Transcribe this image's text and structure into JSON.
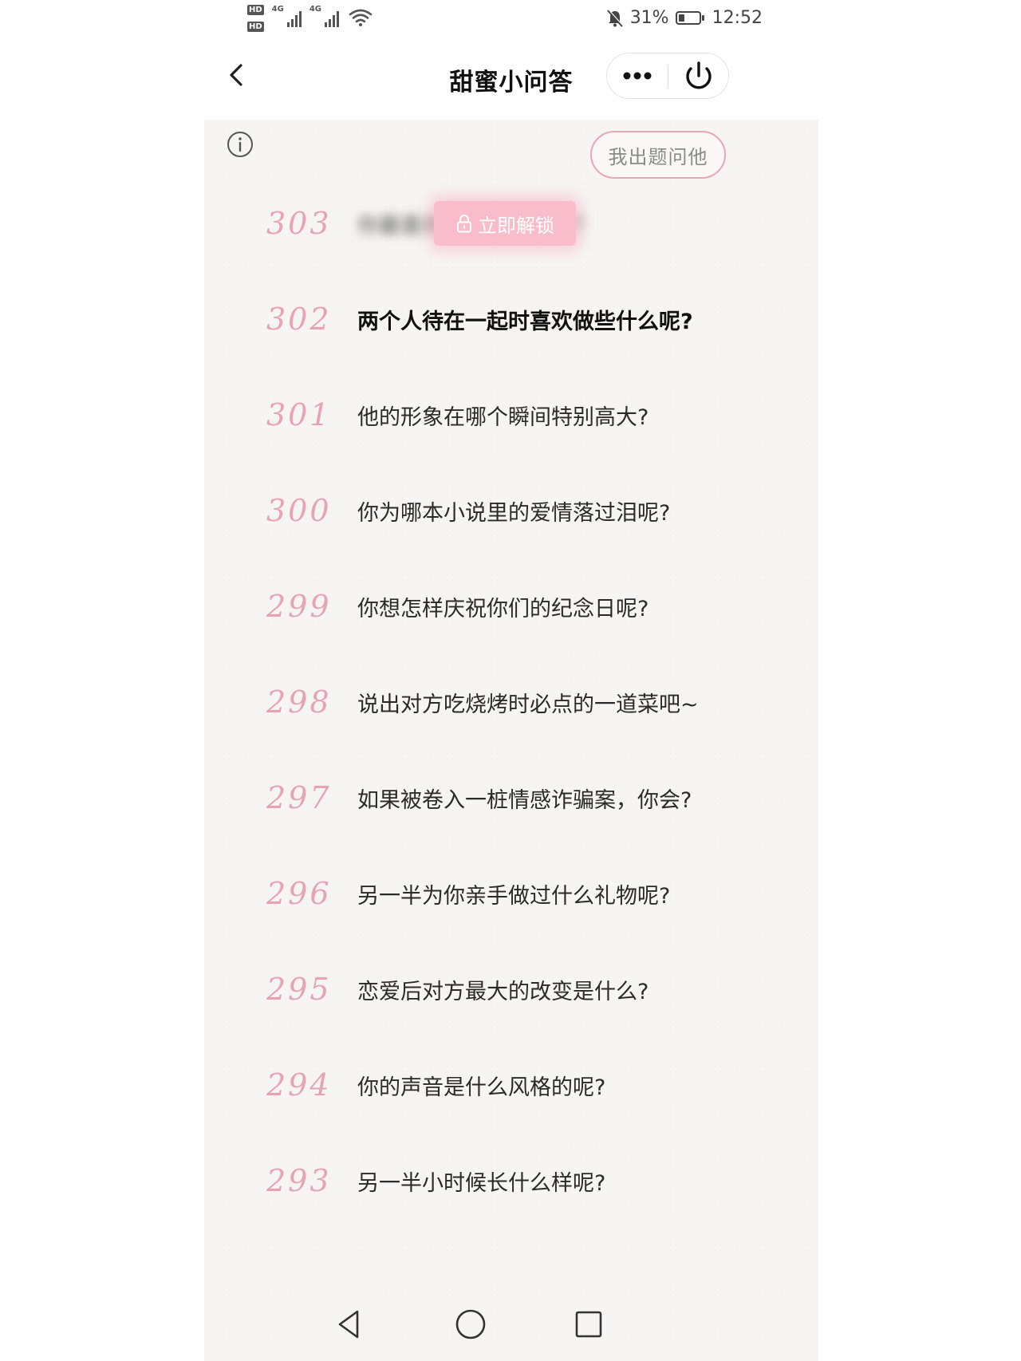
{
  "status_bar": {
    "hd_badges": [
      "HD",
      "HD"
    ],
    "network_1": "4G",
    "network_2": "4G",
    "battery_percent": "31%",
    "battery_level": 0.31,
    "time": "12:52",
    "icons": [
      "signal-icon",
      "wifi-icon",
      "bell-muted-icon",
      "battery-icon"
    ]
  },
  "nav": {
    "title": "甜蜜小问答",
    "back_icon": "chevron-left-icon",
    "more_icon": "more-dots-icon",
    "close_icon": "power-icon"
  },
  "toolbar": {
    "info_icon": "info-icon",
    "ask_button_label": "我出题问他"
  },
  "unlock": {
    "label": "立即解锁",
    "icon": "lock-icon"
  },
  "questions": [
    {
      "number": "303",
      "text": "你最喜欢他的什么样子？",
      "locked": true
    },
    {
      "number": "302",
      "text": "两个人待在一起时喜欢做些什么呢?",
      "locked": false
    },
    {
      "number": "301",
      "text": "他的形象在哪个瞬间特别高大?",
      "locked": false
    },
    {
      "number": "300",
      "text": "你为哪本小说里的爱情落过泪呢?",
      "locked": false
    },
    {
      "number": "299",
      "text": "你想怎样庆祝你们的纪念日呢?",
      "locked": false
    },
    {
      "number": "298",
      "text": "说出对方吃烧烤时必点的一道菜吧~",
      "locked": false
    },
    {
      "number": "297",
      "text": "如果被卷入一桩情感诈骗案，你会?",
      "locked": false
    },
    {
      "number": "296",
      "text": "另一半为你亲手做过什么礼物呢?",
      "locked": false
    },
    {
      "number": "295",
      "text": "恋爱后对方最大的改变是什么?",
      "locked": false
    },
    {
      "number": "294",
      "text": "你的声音是什么风格的呢?",
      "locked": false
    },
    {
      "number": "293",
      "text": "另一半小时候长什么样呢?",
      "locked": false
    }
  ],
  "system_nav": {
    "back": "triangle-back-icon",
    "home": "circle-home-icon",
    "recents": "square-recents-icon"
  },
  "colors": {
    "accent_pink": "#e7a3b4",
    "unlock_pink": "#f9bccb",
    "text_dark": "#2a2a2a"
  }
}
